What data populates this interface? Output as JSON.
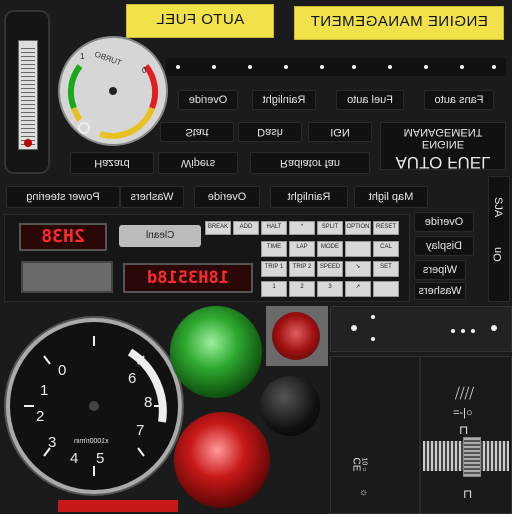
{
  "labels": {
    "auto_fuel": "AUTO FUEL",
    "engine_mgmt": "ENGINE MANAGEMENT",
    "engine_mgmt_small": "ENGINE MANAGEMENT",
    "auto_fuel_big": "AUTO FUEL"
  },
  "switch_row1": [
    "Overide",
    "Rainlight",
    "Fuel auto",
    "Fans auto"
  ],
  "switch_row2": [
    "Start",
    "Dash",
    "IGN"
  ],
  "switch_row3": [
    "Hazard",
    "Wipers",
    "Radiator fan"
  ],
  "switch_row4": [
    "Power steering",
    "Washers",
    "Overide",
    "Rainlight",
    "Map light"
  ],
  "side_buttons": [
    "Overide",
    "Display",
    "Wipers",
    "Washers"
  ],
  "side_vertical": [
    "SJA",
    "On"
  ],
  "turbo_gauge": {
    "label": "TURBO",
    "ticks": [
      "1",
      "0"
    ]
  },
  "lcd": {
    "small": "2H38",
    "big": "18H3518d"
  },
  "logo": "Cleanl",
  "keypad": [
    [
      "BREAK",
      "ADD",
      "HALT",
      "*",
      "SPLIT",
      "OPTION",
      "RESET"
    ],
    [
      "",
      "",
      "TIME",
      "LAP",
      "MODE",
      "",
      "CAL"
    ],
    [
      "",
      "",
      "TRIP 1",
      "TRIP 2",
      "SPEED",
      "",
      "SET"
    ],
    [
      "",
      "",
      "1",
      "2",
      "3",
      "",
      ""
    ]
  ],
  "tacho": {
    "unit": "x1000r/min",
    "numbers": [
      "0",
      "1",
      "2",
      "3",
      "4",
      "5",
      "6",
      "7",
      "8"
    ]
  },
  "colors": {
    "yellow": "#f2e24a",
    "green_light": "#2ea82e",
    "red_light": "#c81818",
    "lcd_red": "#ff2a2a"
  },
  "right_panel": {
    "temp_label": "CE",
    "gear_label": "=-|○",
    "small_text": "10 ○"
  }
}
